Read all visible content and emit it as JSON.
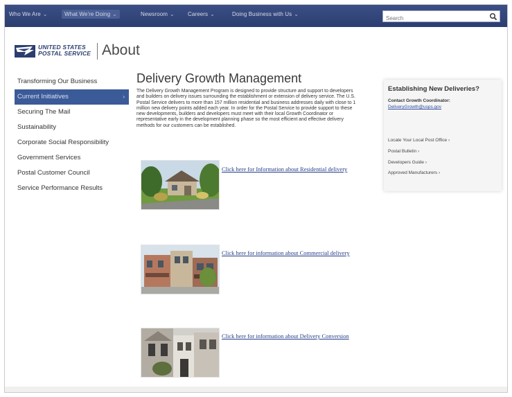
{
  "nav": {
    "items": [
      {
        "label": "Who We Are",
        "chev": "⌄"
      },
      {
        "label": "What We're Doing",
        "chev": "⌄"
      },
      {
        "label": "Newsroom",
        "chev": "⌄"
      },
      {
        "label": "Careers",
        "chev": "⌄"
      },
      {
        "label": "Doing Business with Us",
        "chev": "⌄"
      }
    ],
    "search_placeholder": "Search"
  },
  "header": {
    "brand_line1": "UNITED STATES",
    "brand_line2": "POSTAL SERVICE",
    "section": "About"
  },
  "sidebar": {
    "items": [
      {
        "label": "Transforming Our Business"
      },
      {
        "label": "Current Initiatives",
        "chev": "›"
      },
      {
        "label": "Securing The Mail"
      },
      {
        "label": "Sustainability"
      },
      {
        "label": "Corporate Social Responsibility"
      },
      {
        "label": "Government Services"
      },
      {
        "label": "Postal Customer Council"
      },
      {
        "label": "Service Performance Results"
      }
    ]
  },
  "main": {
    "title": "Delivery Growth Management",
    "intro": "The Delivery Growth Management Program is designed to provide structure and support to developers and builders on delivery issues surrounding the establishment or extension of delivery service. The U.S. Postal Service delivers to more than 157 million residential and business addresses daily with close to 1 million new delivery points added each year. In order for the Postal Service to provide support to these new developments, builders and developers must meet with their local Growth Coordinator or representative early in the development planning phase so the most efficient and effective delivery methods for our customers can be established.",
    "tiles": [
      {
        "link": "Click here for Information about Residential delivery"
      },
      {
        "link": "Click here for information about Commercial delivery"
      },
      {
        "link": "Click here for information about Delivery Conversion"
      }
    ]
  },
  "aside": {
    "title": "Establishing New Deliveries?",
    "contact_label": "Contact Growth Coordinator:",
    "contact_email": "DeliveryGrowth@usps.gov",
    "links": [
      "Locate Your Local Post Office ›",
      "Postal Bulletin ›",
      "Developers Guide ›",
      "Approved Manufacturers ›"
    ]
  }
}
